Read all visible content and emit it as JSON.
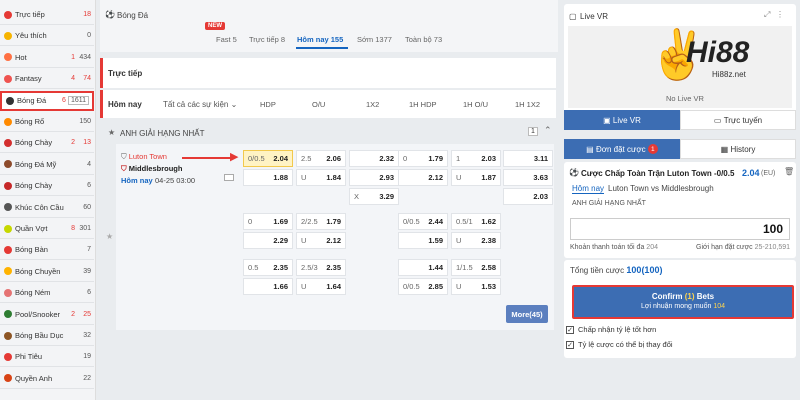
{
  "sidebar": {
    "items": [
      {
        "label": "Trực tiếp",
        "hot": "",
        "count": "18",
        "color": "#e53935",
        "count_red": true
      },
      {
        "label": "Yêu thích",
        "hot": "",
        "count": "0",
        "color": "#f6b400",
        "count_red": false
      },
      {
        "label": "Hot",
        "hot": "1",
        "count": "434",
        "color": "#ff7043",
        "count_red": false
      },
      {
        "label": "Fantasy",
        "hot": "4",
        "count": "74",
        "color": "#ef5350",
        "count_red": true
      },
      {
        "label": "Bóng Đá",
        "hot": "6",
        "count": "1611",
        "color": "#333333",
        "count_red": false
      },
      {
        "label": "Bóng Rổ",
        "hot": "",
        "count": "150",
        "color": "#ff8a00",
        "count_red": false
      },
      {
        "label": "Bóng Chày",
        "hot": "2",
        "count": "13",
        "color": "#d32f2f",
        "count_red": true
      },
      {
        "label": "Bóng Đá Mỹ",
        "hot": "",
        "count": "4",
        "color": "#8d4b2b",
        "count_red": false
      },
      {
        "label": "Bóng Chày",
        "hot": "",
        "count": "6",
        "color": "#c62828",
        "count_red": false
      },
      {
        "label": "Khúc Côn Cầu",
        "hot": "",
        "count": "60",
        "color": "#555555",
        "count_red": false
      },
      {
        "label": "Quần Vợt",
        "hot": "8",
        "count": "301",
        "color": "#c6d800",
        "count_red": false
      },
      {
        "label": "Bóng Bàn",
        "hot": "",
        "count": "7",
        "color": "#e53935",
        "count_red": false
      },
      {
        "label": "Bóng Chuyền",
        "hot": "",
        "count": "39",
        "color": "#ffb300",
        "count_red": false
      },
      {
        "label": "Bóng Ném",
        "hot": "",
        "count": "6",
        "color": "#e57373",
        "count_red": false
      },
      {
        "label": "Pool/Snooker",
        "hot": "2",
        "count": "25",
        "color": "#2e7d32",
        "count_red": true
      },
      {
        "label": "Bóng Bầu Dục",
        "hot": "",
        "count": "32",
        "color": "#8d5524",
        "count_red": false
      },
      {
        "label": "Phi Tiêu",
        "hot": "",
        "count": "19",
        "color": "#e53935",
        "count_red": false
      },
      {
        "label": "Quyền Anh",
        "hot": "",
        "count": "22",
        "color": "#d84315",
        "count_red": false
      }
    ]
  },
  "header": {
    "sport_title": "Bóng Đá",
    "new_badge": "NEW",
    "tabs": [
      "Fast 5",
      "Trực tiếp 8",
      "Hôm nay 155",
      "Sớm 1377",
      "Toàn bộ 73"
    ]
  },
  "live_label": "Trực tiếp",
  "filter": {
    "label": "Hôm nay",
    "select": "Tất cả các sự kiện",
    "columns": [
      "HDP",
      "O/U",
      "1X2",
      "1H HDP",
      "1H O/U",
      "1H 1X2"
    ]
  },
  "league": {
    "name": "ANH GIẢI HẠNG NHẤT",
    "count": "1"
  },
  "match": {
    "home": "Luton Town",
    "away": "Middlesbrough",
    "when_label": "Hôm nay",
    "when": "04-25 03:00"
  },
  "odds_rows": [
    {
      "hdp": [
        "0/0.5",
        "2.04",
        "",
        "1.88"
      ],
      "ou": [
        "2.5",
        "2.06",
        "U",
        "1.84"
      ],
      "x12": [
        "2.32",
        "2.93",
        "3.29"
      ],
      "h1hdp": [
        "0",
        "1.79",
        "",
        "2.12"
      ],
      "h1ou": [
        "1",
        "2.03",
        "U",
        "1.87"
      ],
      "h1x12": [
        "3.11",
        "3.63",
        "2.03"
      ]
    },
    {
      "hdp": [
        "0",
        "1.69",
        "",
        "2.29"
      ],
      "ou": [
        "2/2.5",
        "1.79",
        "U",
        "2.12"
      ],
      "h1hdp": [
        "0/0.5",
        "2.44",
        "",
        "1.59"
      ],
      "h1ou": [
        "0.5/1",
        "1.62",
        "U",
        "2.38"
      ]
    },
    {
      "hdp": [
        "0.5",
        "2.35",
        "",
        "1.66"
      ],
      "ou": [
        "2.5/3",
        "2.35",
        "U",
        "1.64"
      ],
      "h1hdp": [
        "",
        "1.44",
        "0/0.5",
        "2.85"
      ],
      "h1ou": [
        "1/1.5",
        "2.58",
        "U",
        "1.53"
      ]
    }
  ],
  "x_label": "X",
  "more_button": "More(45)",
  "right": {
    "live_vr": "Live VR",
    "logo_text": "Hi88",
    "logo_sub": "Hi88z.net",
    "no_live": "No Live VR",
    "tab_live": "Live VR",
    "tab_online": "Trực tuyến",
    "bet_tab": "Đơn đặt cược",
    "bet_count": "1",
    "history_tab": "History",
    "bet_title": "Cược Chấp Toàn Trận Luton Town -0/0.5",
    "bet_odds": "2.04",
    "bet_odds_type": "(EU)",
    "bet_day": "Hôm nay",
    "bet_match": "Luton Town vs Middlesbrough",
    "bet_league": "ANH GIẢI HẠNG NHẤT",
    "stake": "100",
    "max_pay_label": "Khoản thanh toán tối đa",
    "max_pay": "204",
    "limit_label": "Giới hạn đặt cược",
    "limit": "25-210,591",
    "total_label": "Tổng tiền cược",
    "total": "100(100)",
    "confirm_prefix": "Confirm",
    "confirm_num": "(1)",
    "confirm_suffix": "Bets",
    "profit_label": "Lợi nhuận mong muốn",
    "profit": "104",
    "opt1": "Chấp nhận tỷ lệ tốt hơn",
    "opt2": "Tỷ lệ cược có thể bị thay đổi"
  },
  "colors": {
    "accent": "#1565c0",
    "red": "#e53935",
    "confirm": "#3c6db3",
    "selected": "#fff3c4"
  }
}
